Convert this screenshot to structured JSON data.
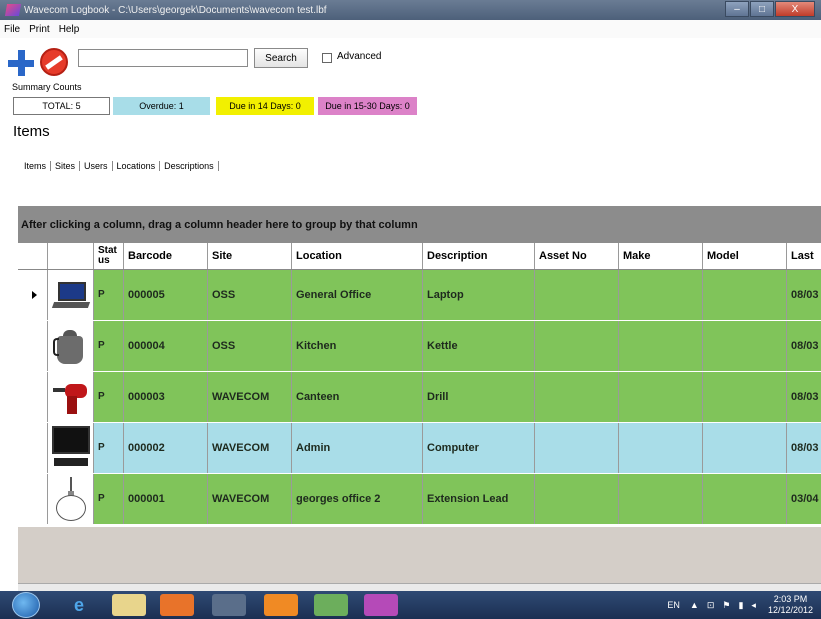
{
  "window": {
    "title": "Wavecom Logbook - C:\\Users\\georgek\\Documents\\wavecom test.lbf",
    "min": "–",
    "max": "□",
    "close": "X"
  },
  "menu": {
    "file": "File",
    "print": "Print",
    "help": "Help"
  },
  "toolbar": {
    "search_value": "",
    "search_label": "Search",
    "advanced_label": "Advanced"
  },
  "summary": {
    "label": "Summary Counts",
    "total": "TOTAL: 5",
    "overdue": "Overdue: 1",
    "due14": "Due in 14 Days: 0",
    "due1530": "Due in 15-30 Days: 0",
    "colors": {
      "overdue": "#a8dde8",
      "due14": "#f2f000",
      "due1530": "#dc82c8"
    }
  },
  "items_heading": "Items",
  "tabs": [
    "Items",
    "Sites",
    "Users",
    "Locations",
    "Descriptions"
  ],
  "group_panel": "After clicking a column, drag a column header here to group by that column",
  "grid": {
    "columns": [
      "Stat us",
      "Barcode",
      "Site",
      "Location",
      "Description",
      "Asset No",
      "Make",
      "Model",
      "Last"
    ],
    "rows": [
      {
        "icon": "laptop-icon",
        "status": "P",
        "barcode": "000005",
        "site": "OSS",
        "location": "General Office",
        "description": "Laptop",
        "asset_no": "",
        "make": "",
        "model": "",
        "last": "08/03",
        "color": "green",
        "selected": true
      },
      {
        "icon": "kettle-icon",
        "status": "P",
        "barcode": "000004",
        "site": "OSS",
        "location": "Kitchen",
        "description": "Kettle",
        "asset_no": "",
        "make": "",
        "model": "",
        "last": "08/03",
        "color": "green",
        "selected": false
      },
      {
        "icon": "drill-icon",
        "status": "P",
        "barcode": "000003",
        "site": "WAVECOM",
        "location": "Canteen",
        "description": "Drill",
        "asset_no": "",
        "make": "",
        "model": "",
        "last": "08/03",
        "color": "green",
        "selected": false
      },
      {
        "icon": "computer-icon",
        "status": "P",
        "barcode": "000002",
        "site": "WAVECOM",
        "location": "Admin",
        "description": "Computer",
        "asset_no": "",
        "make": "",
        "model": "",
        "last": "08/03",
        "color": "blue",
        "selected": false
      },
      {
        "icon": "extension-lead-icon",
        "status": "P",
        "barcode": "000001",
        "site": "WAVECOM",
        "location": "georges office 2",
        "description": "Extension Lead",
        "asset_no": "",
        "make": "",
        "model": "",
        "last": "03/04",
        "color": "green",
        "selected": false
      }
    ]
  },
  "taskbar": {
    "lang": "EN",
    "time": "2:03 PM",
    "date": "12/12/2012"
  }
}
